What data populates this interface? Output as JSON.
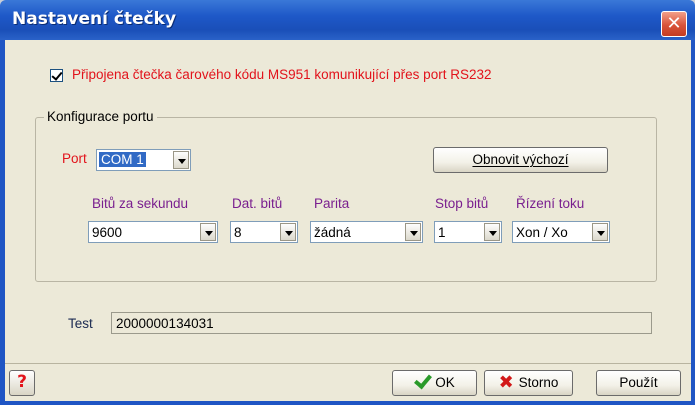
{
  "window": {
    "title": "Nastavení čtečky",
    "close_label": "✕"
  },
  "reader": {
    "enabled_label": "Připojena čtečka čarového kódu MS951 komunikující přes port RS232",
    "enabled": true
  },
  "port_config": {
    "group_label": "Konfigurace portu",
    "port_label": "Port",
    "port_value": "COM 1",
    "reset_button_label": "Obnovit výchozí",
    "fields": [
      {
        "label": "Bitů za sekundu",
        "value": "9600"
      },
      {
        "label": "Dat. bitů",
        "value": "8"
      },
      {
        "label": "Parita",
        "value": "žádná"
      },
      {
        "label": "Stop bitů",
        "value": "1"
      },
      {
        "label": "Řízení toku",
        "value": "Xon / Xo"
      }
    ]
  },
  "test": {
    "label": "Test",
    "value": "2000000134031"
  },
  "footer": {
    "help_label": "?",
    "ok_label": "OK",
    "cancel_label": "Storno",
    "apply_label": "Použít"
  },
  "colors": {
    "titlebar": "#1e58c8",
    "label_red": "#e2131b",
    "label_purple": "#7a1f8f",
    "dialog_bg": "#ece9d8"
  }
}
